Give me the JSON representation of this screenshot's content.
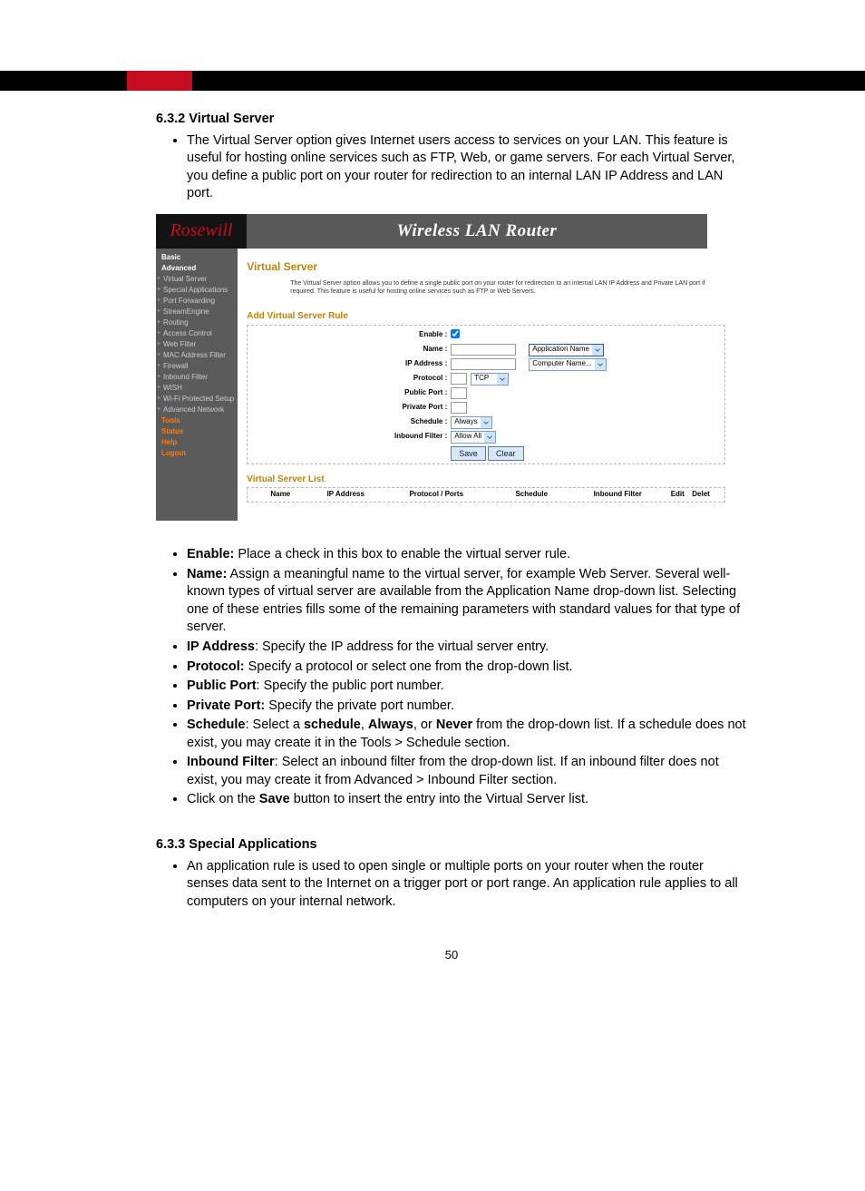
{
  "section_632": {
    "heading": "6.3.2  Virtual Server",
    "intro": "The Virtual Server option gives Internet users access to services on your LAN. This feature is useful for hosting online services such as FTP, Web, or game servers. For each Virtual Server, you define a public port on your router for redirection to an internal LAN IP Address and LAN port."
  },
  "router_ui": {
    "brand": "Rosewill",
    "title": "Wireless LAN Router",
    "nav": {
      "basic": "Basic",
      "advanced": "Advanced",
      "virtual_server": "Virtual Server",
      "special_apps": "Special Applications",
      "port_forwarding": "Port Forwarding",
      "stream_engine": "StreamEngine",
      "routing": "Routing",
      "access_control": "Access Control",
      "web_filter": "Web Filter",
      "mac_filter": "MAC Address Filter",
      "firewall": "Firewall",
      "inbound_filter": "Inbound Filter",
      "wish": "WISH",
      "wps": "Wi-Fi Protected Setup",
      "adv_network": "Advanced Network",
      "tools": "Tools",
      "status": "Status",
      "help": "Help",
      "logout": "Logout"
    },
    "page": {
      "h1": "Virtual Server",
      "desc": "The Virtual Server option allows you to define a single public port on your router for redirection to an internal LAN IP Address and Private LAN port if required. This feature is useful for hosting online services such as FTP or Web Servers.",
      "h2_add": "Add Virtual Server Rule",
      "h2_list": "Virtual Server List",
      "labels": {
        "enable": "Enable :",
        "name": "Name :",
        "ip": "IP Address :",
        "protocol": "Protocol :",
        "public_port": "Public Port :",
        "private_port": "Private Port :",
        "schedule": "Schedule :",
        "inbound": "Inbound Filter :"
      },
      "dropdowns": {
        "app_name": "Application Name",
        "computer_name": "Computer Name...",
        "protocol": "TCP",
        "schedule": "Always",
        "inbound": "Allow All"
      },
      "buttons": {
        "save": "Save",
        "clear": "Clear"
      },
      "list_columns": {
        "name": "Name",
        "ip": "IP Address",
        "ports": "Protocol / Ports",
        "schedule": "Schedule",
        "inbound": "Inbound Filter",
        "edit": "Edit",
        "delete": "Delet"
      }
    }
  },
  "definitions": {
    "enable_b": "Enable:",
    "enable_t": " Place a check in this box to enable the virtual server rule.",
    "name_b": "Name:",
    "name_t": " Assign a meaningful name to the virtual server, for example Web Server. Several well-known types of virtual server are available from the Application Name drop-down list. Selecting one of these entries fills some of the remaining parameters with standard values for that type of server.",
    "ip_b": "IP Address",
    "ip_t": ": Specify the IP address for the virtual server entry.",
    "proto_b": "Protocol:",
    "proto_t": " Specify a protocol or select one from the drop-down list.",
    "pub_b": "Public Port",
    "pub_t": ": Specify the public port number.",
    "priv_b": "Private Port:",
    "priv_t": " Specify the private port number.",
    "sched_b": "Schedule",
    "sched_t1": ": Select a ",
    "sched_b2": "schedule",
    "sched_t2": ", ",
    "sched_b3": "Always",
    "sched_t3": ", or ",
    "sched_b4": "Never",
    "sched_t4": " from the drop-down list. If a schedule does not exist, you may create it in the Tools > Schedule section.",
    "if_b": "Inbound Filter",
    "if_t": ": Select an inbound filter from the drop-down list. If an inbound filter does not exist, you may create it from Advanced > Inbound Filter section.",
    "save_t1": "Click on the ",
    "save_b": "Save",
    "save_t2": " button to insert the entry into the Virtual Server list."
  },
  "section_633": {
    "heading": "6.3.3  Special Applications",
    "intro": "An application rule is used to open single or multiple ports on your router when the router senses data sent to the Internet on a trigger port or port range. An application rule applies to all computers on your internal network."
  },
  "page_number": "50"
}
